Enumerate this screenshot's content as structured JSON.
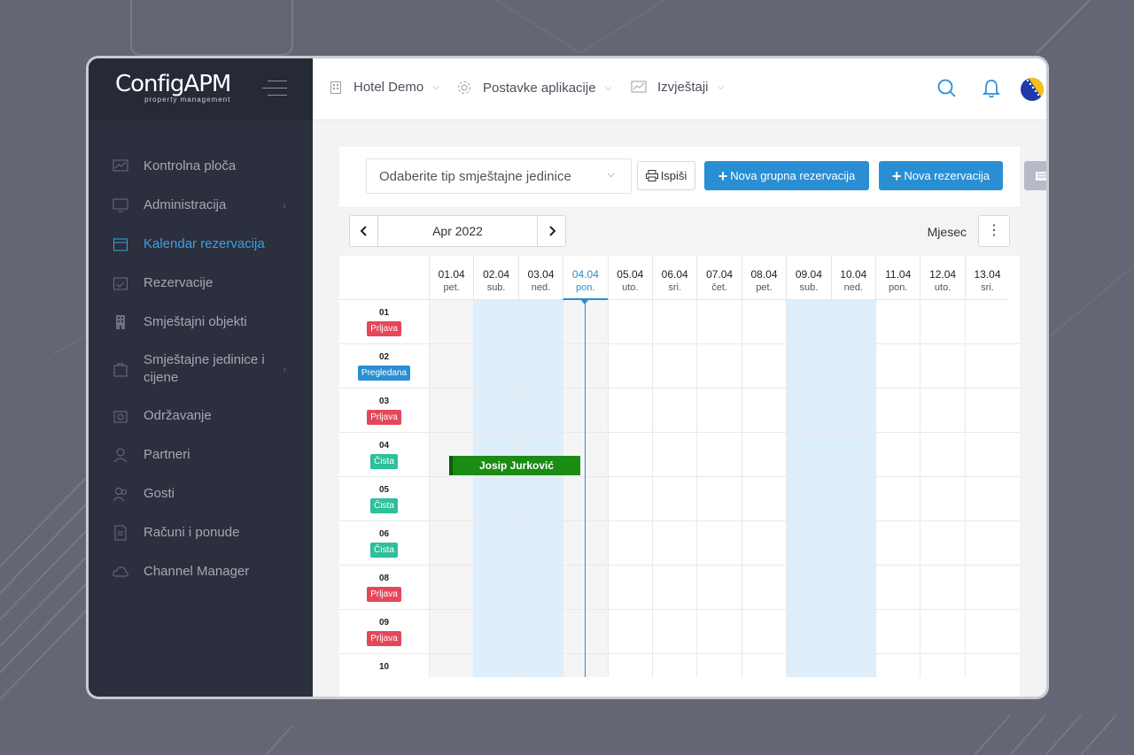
{
  "brand": {
    "name": "ConfigAPM",
    "tagline": "property management"
  },
  "sidebar": {
    "items": [
      {
        "label": "Kontrolna ploča",
        "icon": "dashboard-icon"
      },
      {
        "label": "Administracija",
        "icon": "monitor-icon",
        "has_children": true
      },
      {
        "label": "Kalendar rezervacija",
        "icon": "calendar-icon",
        "active": true
      },
      {
        "label": "Rezervacije",
        "icon": "calendar-check-icon"
      },
      {
        "label": "Smještajni objekti",
        "icon": "building-icon"
      },
      {
        "label": "Smještajne jedinice i cijene",
        "icon": "bag-icon",
        "has_children": true
      },
      {
        "label": "Održavanje",
        "icon": "maintenance-icon"
      },
      {
        "label": "Partneri",
        "icon": "user-icon"
      },
      {
        "label": "Gosti",
        "icon": "users-icon"
      },
      {
        "label": "Računi i ponude",
        "icon": "invoice-icon"
      },
      {
        "label": "Channel Manager",
        "icon": "cloud-icon"
      }
    ]
  },
  "topbar": {
    "hotel": "Hotel Demo",
    "settings": "Postavke aplikacije",
    "reports": "Izvještaji"
  },
  "toolbar": {
    "unit_type_placeholder": "Odaberite tip smještajne jedinice",
    "print_label": "Ispiši",
    "new_group_label": "Nova grupna rezervacija",
    "new_reservation_label": "Nova rezervacija"
  },
  "calendar": {
    "month_label": "Apr 2022",
    "view_label": "Mjesec",
    "days": [
      {
        "date": "01.04",
        "dow": "pet.",
        "weekend": false
      },
      {
        "date": "02.04",
        "dow": "sub.",
        "weekend": true
      },
      {
        "date": "03.04",
        "dow": "ned.",
        "weekend": true
      },
      {
        "date": "04.04",
        "dow": "pon.",
        "weekend": false,
        "today": true
      },
      {
        "date": "05.04",
        "dow": "uto.",
        "weekend": false
      },
      {
        "date": "06.04",
        "dow": "sri.",
        "weekend": false
      },
      {
        "date": "07.04",
        "dow": "čet.",
        "weekend": false
      },
      {
        "date": "08.04",
        "dow": "pet.",
        "weekend": false
      },
      {
        "date": "09.04",
        "dow": "sub.",
        "weekend": true
      },
      {
        "date": "10.04",
        "dow": "ned.",
        "weekend": true
      },
      {
        "date": "11.04",
        "dow": "pon.",
        "weekend": false
      },
      {
        "date": "12.04",
        "dow": "uto.",
        "weekend": false
      },
      {
        "date": "13.04",
        "dow": "sri.",
        "weekend": false
      }
    ],
    "rooms": [
      {
        "number": "01",
        "status": "Prljava",
        "color": "#e5475a"
      },
      {
        "number": "02",
        "status": "Pregledana",
        "color": "#2a8ed3"
      },
      {
        "number": "03",
        "status": "Prljava",
        "color": "#e5475a"
      },
      {
        "number": "04",
        "status": "Čista",
        "color": "#2fbf9a"
      },
      {
        "number": "05",
        "status": "Čista",
        "color": "#2fbf9a"
      },
      {
        "number": "06",
        "status": "Čista",
        "color": "#2fbf9a"
      },
      {
        "number": "08",
        "status": "Prljava",
        "color": "#e5475a"
      },
      {
        "number": "09",
        "status": "Prljava",
        "color": "#e5475a"
      },
      {
        "number": "10",
        "status": "",
        "color": ""
      }
    ],
    "bookings": [
      {
        "guest": "Josip Jurković",
        "room_index": 3,
        "start_day": 0.45,
        "end_day": 3.4,
        "color": "#1a8b13"
      }
    ]
  }
}
